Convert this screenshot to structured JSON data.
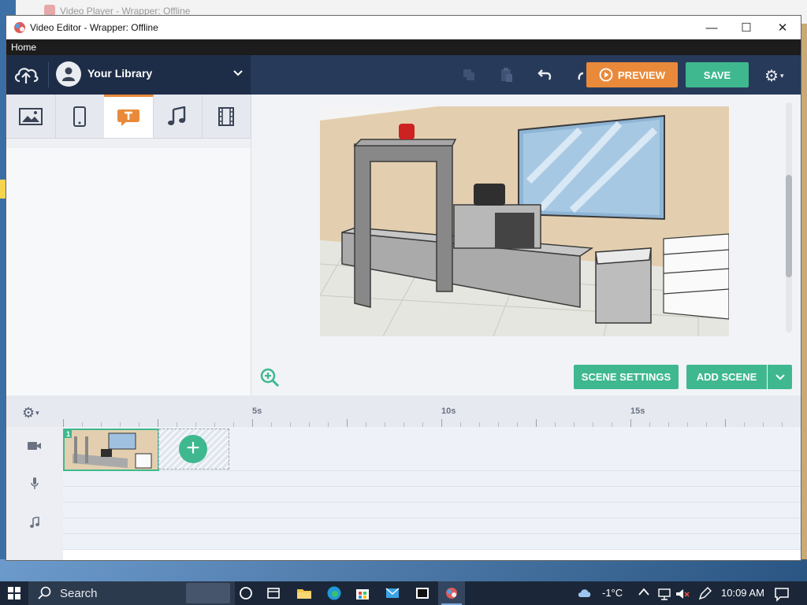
{
  "background_window": {
    "title": "Video Player - Wrapper: Offline"
  },
  "window": {
    "title": "Video Editor - Wrapper: Offline",
    "minimize": "—",
    "maximize": "☐",
    "close": "✕"
  },
  "menu": {
    "home": "Home"
  },
  "topbar": {
    "library_name": "Your Library",
    "library_chevron": "⌄",
    "preview_label": "PREVIEW",
    "save_label": "SAVE",
    "settings_icon": "gear-icon",
    "gear_chevron": "▾"
  },
  "asset_tabs": [
    "image-icon",
    "phone-icon",
    "text-icon",
    "music-icon",
    "film-icon"
  ],
  "stage": {
    "scene_settings_label": "SCENE SETTINGS",
    "add_scene_label": "ADD SCENE",
    "add_scene_dropdown": "⌄"
  },
  "timeline": {
    "settings_chevron": "▾",
    "ticks": [
      "5s",
      "10s",
      "15s"
    ],
    "scene_number": "1",
    "add_scene_plus": "+",
    "track_icons": [
      "camera-icon",
      "microphone-icon",
      "music-note-icon"
    ]
  },
  "taskbar": {
    "search_label": "Search",
    "temperature": "-1°C",
    "time": "10:09 AM"
  },
  "colors": {
    "accent_green": "#3fb88f",
    "accent_orange": "#e98a3b",
    "topbar_navy": "#283a5a"
  }
}
